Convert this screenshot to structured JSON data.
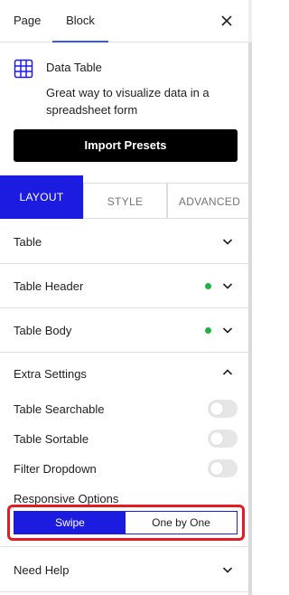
{
  "tabs": {
    "page": "Page",
    "block": "Block"
  },
  "block": {
    "title": "Data Table",
    "description": "Great way to visualize data in a spreadsheet form",
    "import_button": "Import Presets"
  },
  "inspector_tabs": {
    "layout": "LAYOUT",
    "style": "STYLE",
    "advanced": "ADVANCED",
    "active": "layout"
  },
  "panels": {
    "table": "Table",
    "table_header": "Table Header",
    "table_body": "Table Body",
    "extra_settings": "Extra Settings",
    "need_help": "Need Help"
  },
  "extra": {
    "toggles": [
      {
        "label": "Table Searchable",
        "on": false
      },
      {
        "label": "Table Sortable",
        "on": false
      },
      {
        "label": "Filter Dropdown",
        "on": false
      }
    ],
    "responsive_label": "Responsive Options",
    "responsive_options": [
      "Swipe",
      "One by One"
    ],
    "responsive_selected": "Swipe"
  },
  "colors": {
    "accent": "#1c1ce0",
    "highlight": "#e31b23",
    "status_dot": "#1fb141",
    "tab_underline": "#3858e9"
  }
}
